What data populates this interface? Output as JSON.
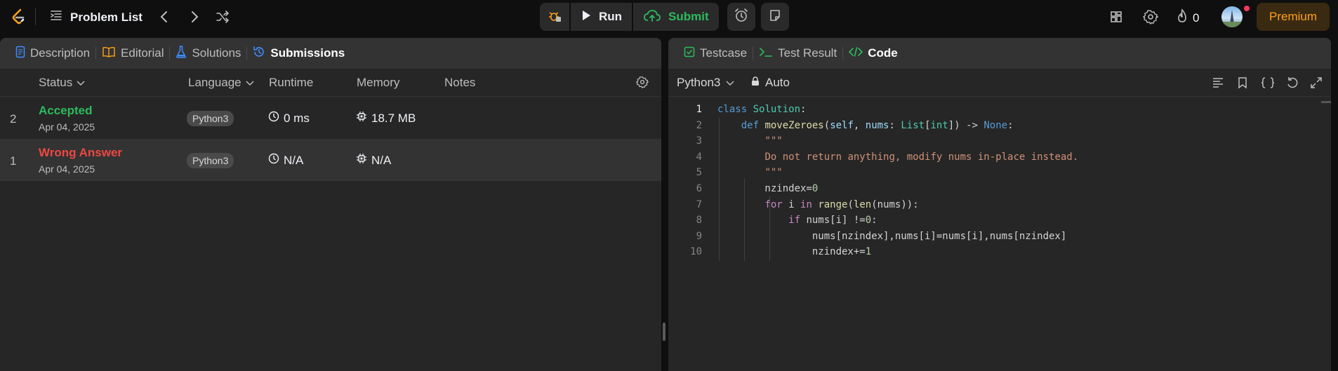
{
  "topbar": {
    "problem_list_label": "Problem List",
    "run_label": "Run",
    "submit_label": "Submit",
    "streak_count": "0",
    "premium_label": "Premium"
  },
  "left_tabs": [
    {
      "label": "Description"
    },
    {
      "label": "Editorial"
    },
    {
      "label": "Solutions"
    },
    {
      "label": "Submissions"
    }
  ],
  "right_tabs": [
    {
      "label": "Testcase"
    },
    {
      "label": "Test Result"
    },
    {
      "label": "Code"
    }
  ],
  "table": {
    "headers": {
      "status": "Status",
      "language": "Language",
      "runtime": "Runtime",
      "memory": "Memory",
      "notes": "Notes"
    },
    "rows": [
      {
        "index": "2",
        "status": "Accepted",
        "date": "Apr 04, 2025",
        "language": "Python3",
        "runtime": "0 ms",
        "memory": "18.7 MB"
      },
      {
        "index": "1",
        "status": "Wrong Answer",
        "date": "Apr 04, 2025",
        "language": "Python3",
        "runtime": "N/A",
        "memory": "N/A"
      }
    ]
  },
  "editor": {
    "language": "Python3",
    "mode": "Auto",
    "line_numbers": [
      "1",
      "2",
      "3",
      "4",
      "5",
      "6",
      "7",
      "8",
      "9",
      "10"
    ]
  },
  "colors": {
    "accepted": "#2cbb5d",
    "wrong": "#ef4743",
    "premium": "#ffa116",
    "active_tab_blue": "#3f8cff"
  }
}
